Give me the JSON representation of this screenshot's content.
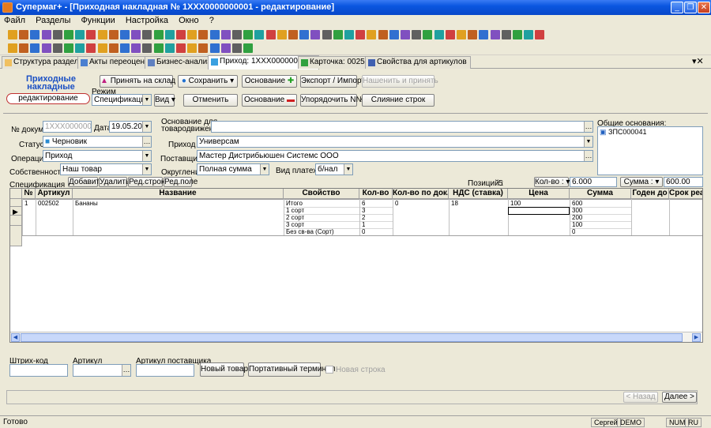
{
  "window": {
    "title": "Супермаг+ - [Приходная накладная № 1XXX0000000001 - редактирование]"
  },
  "menu": [
    "Файл",
    "Разделы",
    "Функции",
    "Настройка",
    "Окно",
    "?"
  ],
  "tabs": [
    {
      "label": "Структура разделов"
    },
    {
      "label": "Акты переоценки"
    },
    {
      "label": "Бизнес-анализ"
    },
    {
      "label": "Приход: 1XXX0000000001"
    },
    {
      "label": "Карточка: 002502"
    },
    {
      "label": "Свойства для артикулов"
    }
  ],
  "doc": {
    "heading_line1": "Приходные",
    "heading_line2": "накладные",
    "mode_badge": "редактирование",
    "btn_accept": "Принять на склад",
    "btn_save": "Сохранить",
    "btn_basis_plus": "Основание",
    "btn_export": "Экспорт / Импорт",
    "btn_find_accept": "Нашенить и принять",
    "mode_label": "Режим",
    "mode_value": "Спецификация",
    "view_label": "Вид",
    "btn_cancel": "Отменить",
    "btn_basis_minus": "Основание",
    "btn_order": "Упорядочить N№",
    "btn_merge": "Слияние строк"
  },
  "form": {
    "docno_label": "№ докум.",
    "docno_value": "1XXX00000000C",
    "date_label": "Дата",
    "date_value": "19.05.2009",
    "basis_label_1": "Основание для",
    "basis_label_2": "товародвижения",
    "basis_value": "",
    "common_basis_label": "Общие основания:",
    "common_basis_value": "ЗПС000041",
    "status_label": "Статус",
    "status_value": "Черновик",
    "income_label": "Приход в",
    "income_value": "Универсам",
    "operation_label": "Операция",
    "operation_value": "Приход",
    "supplier_label": "Поставщик",
    "supplier_value": "Мастер Дистрибьюшен Системс ООО",
    "ownership_label": "Собственность",
    "ownership_value": "Наш товар",
    "rounding_label": "Округление",
    "rounding_value": "Полная сумма",
    "payment_label": "Вид платежа",
    "payment_value": "б/нал"
  },
  "spec": {
    "label": "Спецификация",
    "btn_add": "Добавить",
    "btn_delete": "Удалить",
    "btn_edit_row": "Ред.строку",
    "btn_edit_field": "Ред.поле",
    "positions_label": "Позиций :",
    "positions_value": "5",
    "qty_label": "Кол-во :",
    "qty_value": "6.000",
    "sum_label": "Сумма :",
    "sum_value": "600.00"
  },
  "grid": {
    "headers": [
      "№",
      "Артикул",
      "Название",
      "Свойство",
      "Кол-во",
      "Кол-во по док.",
      "НДС (ставка)",
      "Цена",
      "Сумма",
      "Годен до",
      "Срок реа"
    ],
    "row": {
      "no": "1",
      "article": "002502",
      "name": "Бананы",
      "vat": "18",
      "price": "100",
      "qty_doc": "0",
      "sub": [
        {
          "prop": "Итого",
          "qty": "6",
          "sum": "600"
        },
        {
          "prop": "1 сорт",
          "qty": "3",
          "sum": "300"
        },
        {
          "prop": "2 сорт",
          "qty": "2",
          "sum": "200"
        },
        {
          "prop": "3 сорт",
          "qty": "1",
          "sum": "100"
        },
        {
          "prop": "Без св-ва (Сорт)",
          "qty": "0",
          "sum": "0"
        }
      ]
    }
  },
  "bottom": {
    "barcode_label": "Штрих-код",
    "article_label": "Артикул",
    "supplier_article_label": "Артикул поставщика",
    "btn_new": "Новый товар",
    "btn_terminal": "Портативный терминал",
    "new_row_label": "Новая строка",
    "btn_back": "< Назад",
    "btn_next": "Далее >"
  },
  "statusbar": {
    "left": "Готово",
    "user": "Сергей",
    "db": "DEMO",
    "num": "NUM",
    "lang": "RU"
  }
}
